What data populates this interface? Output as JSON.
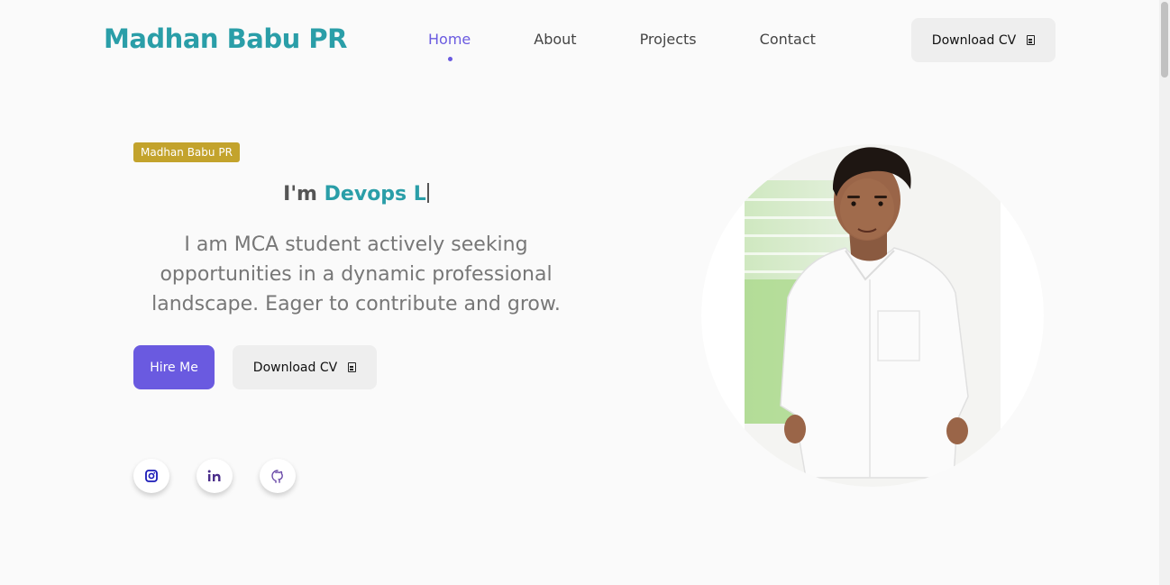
{
  "header": {
    "brand": "Madhan Babu PR",
    "nav": [
      {
        "label": "Home",
        "active": true
      },
      {
        "label": "About"
      },
      {
        "label": "Projects"
      },
      {
        "label": "Contact"
      }
    ],
    "download_cv": "Download CV",
    "download_icon": "document-icon"
  },
  "hero": {
    "badge": "Madhan Babu PR",
    "role_prefix": "I'm",
    "role_typed": "Devops L",
    "intro": "I am MCA student actively seeking opportunities in a dynamic professional landscape. Eager to contribute and grow.",
    "hire_label": "Hire Me",
    "download_cv": "Download CV",
    "social": [
      {
        "icon": "instagram-icon"
      },
      {
        "icon": "linkedin-icon"
      },
      {
        "icon": "github-icon"
      }
    ]
  },
  "colors": {
    "brand": "#2a9ea8",
    "accent": "#6a5ae0",
    "badge": "#c3a32c",
    "background": "#fafafa"
  }
}
